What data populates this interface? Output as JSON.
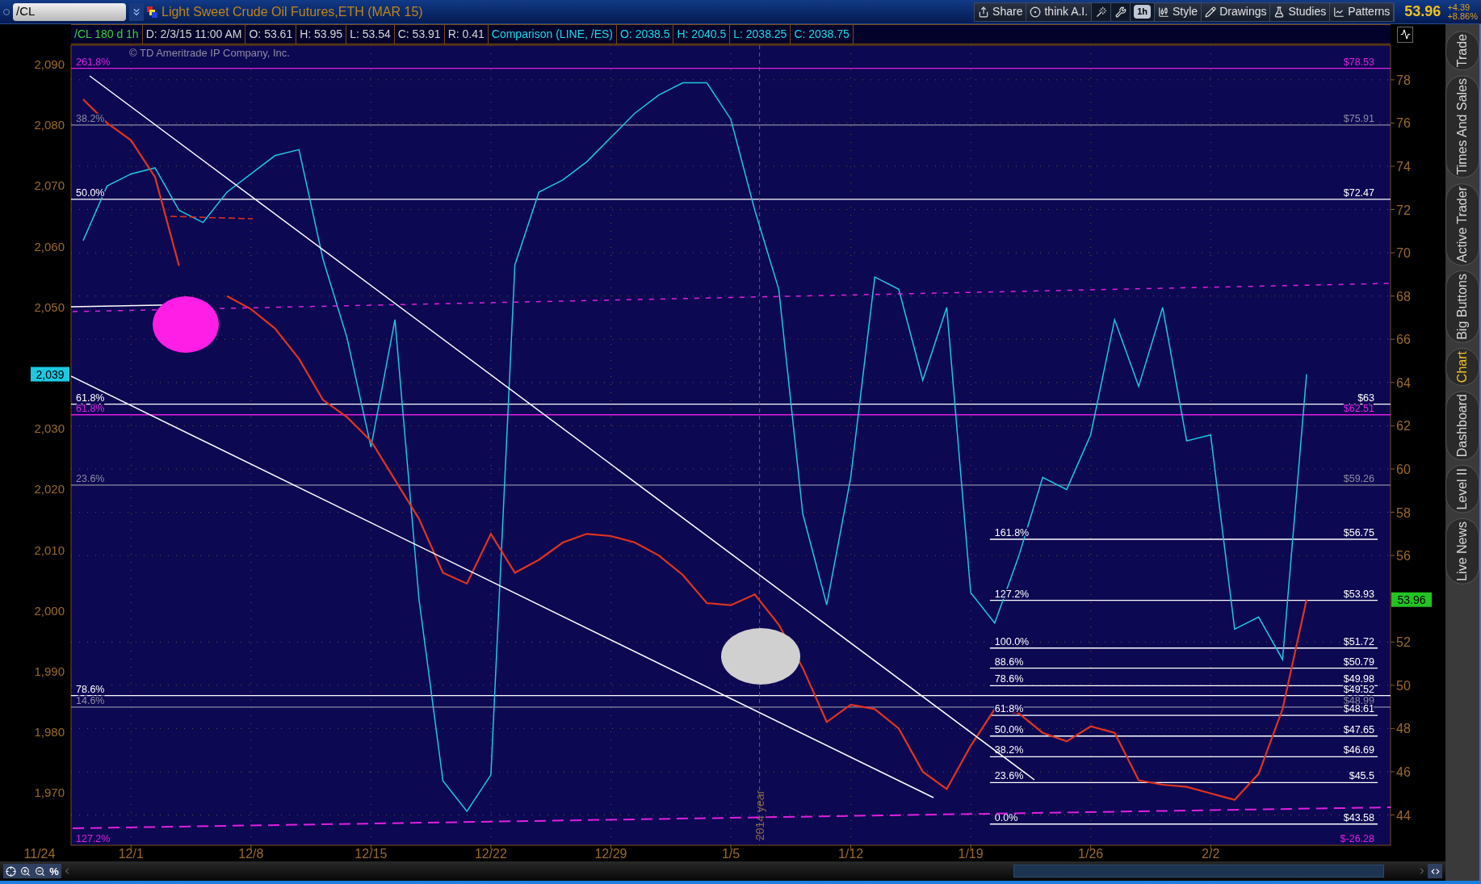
{
  "header": {
    "symbol": "/CL",
    "title": "Light Sweet Crude Oil Futures,ETH (MAR 15)",
    "toolbar": [
      {
        "kind": "button",
        "label": "Share"
      },
      {
        "kind": "button",
        "label": "think A.I."
      },
      {
        "kind": "icon"
      },
      {
        "kind": "icon"
      },
      {
        "kind": "chip",
        "label": "1h"
      },
      {
        "kind": "button",
        "label": "Style"
      },
      {
        "kind": "button",
        "label": "Drawings"
      },
      {
        "kind": "button",
        "label": "Studies"
      },
      {
        "kind": "button",
        "label": "Patterns"
      }
    ],
    "last_price": "53.96",
    "change": "+4.39",
    "change_percent": "+8.86%"
  },
  "info_bar": [
    {
      "kind": "study",
      "text": "/CL 180 d 1h"
    },
    {
      "kind": "quote",
      "text": "D: 2/3/15 11:00 AM"
    },
    {
      "kind": "quote",
      "text": "O: 53.61"
    },
    {
      "kind": "quote",
      "text": "H: 53.95"
    },
    {
      "kind": "quote",
      "text": "L: 53.54"
    },
    {
      "kind": "quote",
      "text": "C: 53.91"
    },
    {
      "kind": "quote",
      "text": "R: 0.41"
    },
    {
      "kind": "comparison",
      "text": "Comparison (LINE, /ES)"
    },
    {
      "kind": "comparison",
      "text": "O: 2038.5"
    },
    {
      "kind": "comparison",
      "text": "H: 2040.5"
    },
    {
      "kind": "comparison",
      "text": "L: 2038.25"
    },
    {
      "kind": "comparison",
      "text": "C: 2038.75"
    }
  ],
  "chart": {
    "copyright": "© TD Ameritrade IP Company, Inc.",
    "first_date_label": "11/24",
    "separator_label": "2014 year",
    "badges": [
      {
        "text": "2,039",
        "color": "#1ec8e0"
      },
      {
        "text": "53.96",
        "color": "#22c322"
      }
    ],
    "fib_levels": [
      {
        "percent": "261.8%",
        "kind": "full"
      },
      {
        "percent": "38.2%",
        "kind": "full"
      },
      {
        "percent": "50.0%",
        "kind": "full"
      },
      {
        "percent": "61.8%",
        "kind": "full"
      },
      {
        "percent": "61.8%",
        "kind": "full"
      },
      {
        "percent": "23.6%",
        "kind": "full"
      },
      {
        "percent": "78.6%",
        "kind": "full"
      },
      {
        "percent": "14.6%",
        "kind": "full"
      },
      {
        "percent": "161.8%",
        "kind": "partial"
      },
      {
        "percent": "127.2%",
        "kind": "partial"
      },
      {
        "percent": "100.0%",
        "kind": "partial"
      },
      {
        "percent": "88.6%",
        "kind": "partial"
      },
      {
        "percent": "78.6%",
        "kind": "partial"
      },
      {
        "percent": "61.8%",
        "kind": "partial"
      },
      {
        "percent": "50.0%",
        "kind": "partial"
      },
      {
        "percent": "38.2%",
        "kind": "partial"
      },
      {
        "percent": "23.6%",
        "kind": "partial"
      },
      {
        "percent": "0.0%",
        "kind": "partial"
      }
    ],
    "offscale_level": {
      "percent": "127.2%",
      "price": "$-26.28"
    },
    "chart_data": {
      "type": "line",
      "grid": true,
      "ylim": [
        1961.4,
        2093.2
      ],
      "y2lim": [
        42.6,
        79.6
      ],
      "categories": [
        null,
        null,
        "12/1",
        null,
        null,
        null,
        null,
        "12/8",
        null,
        null,
        null,
        null,
        "12/15",
        null,
        null,
        null,
        null,
        "12/22",
        null,
        null,
        null,
        null,
        "12/29",
        null,
        null,
        null,
        null,
        "1/5",
        null,
        null,
        null,
        null,
        "1/12",
        null,
        null,
        null,
        null,
        "1/19",
        null,
        null,
        null,
        null,
        "1/26",
        null,
        null,
        null,
        null,
        "2/2",
        null,
        null,
        null,
        null,
        null,
        null,
        null
      ],
      "yticks": [
        {
          "value": 2090,
          "label": "2,090"
        },
        {
          "value": 2080,
          "label": "2,080"
        },
        {
          "value": 2070,
          "label": "2,070"
        },
        {
          "value": 2060,
          "label": "2,060"
        },
        {
          "value": 2050,
          "label": "2,050"
        },
        {
          "value": 2030,
          "label": "2,030"
        },
        {
          "value": 2020,
          "label": "2,020"
        },
        {
          "value": 2010,
          "label": "2,010"
        },
        {
          "value": 2000,
          "label": "2,000"
        },
        {
          "value": 1990,
          "label": "1,990"
        },
        {
          "value": 1980,
          "label": "1,980"
        },
        {
          "value": 1970,
          "label": "1,970"
        }
      ],
      "y2ticks": [
        78,
        76,
        74,
        72,
        70,
        68,
        66,
        64,
        62,
        60,
        58,
        56,
        52,
        50,
        48,
        46,
        44
      ],
      "series": [
        {
          "color": "#1ec8e0",
          "values": [
            2061,
            2070,
            2072,
            2073,
            2066,
            2064,
            2069,
            2072,
            2075,
            2076,
            2058,
            2045,
            2027,
            2048,
            2002,
            1972,
            1967,
            1973,
            2057,
            2069,
            2071,
            2074,
            2078,
            2082,
            2085,
            2087,
            2087,
            2081,
            2066,
            2053,
            2016,
            2001,
            2022,
            2055,
            2053,
            2038,
            2050,
            2003,
            1998,
            2009,
            2022,
            2020,
            2029,
            2048,
            2037,
            2050,
            2028,
            2029,
            1997,
            1999,
            1992,
            2039,
            null,
            null,
            null
          ]
        },
        {
          "color": "#e0341e",
          "axis": "y2",
          "values": [
            77.1,
            76.0,
            75.2,
            73.5,
            69.4,
            null,
            68.0,
            67.4,
            66.5,
            65.1,
            63.2,
            62.4,
            61.3,
            59.5,
            57.7,
            55.2,
            54.7,
            57.0,
            55.2,
            55.8,
            56.6,
            57.0,
            56.9,
            56.6,
            56.0,
            55.1,
            53.8,
            53.7,
            54.2,
            52.8,
            50.8,
            48.3,
            49.1,
            48.9,
            48.0,
            46.0,
            45.2,
            47.2,
            48.9,
            48.7,
            47.8,
            47.4,
            48.1,
            47.8,
            45.6,
            45.4,
            45.3,
            45.0,
            44.7,
            45.9,
            48.9,
            53.96,
            null,
            null,
            null
          ]
        }
      ],
      "ref_lines": [
        {
          "axis": "y2",
          "value": 78.53,
          "color": "#e020e0",
          "label": "$78.53"
        },
        {
          "axis": "y2",
          "value": 75.91,
          "color": "#8c8ca0",
          "label": "$75.91"
        },
        {
          "axis": "y2",
          "value": 72.47,
          "color": "#ffffff",
          "label": "$72.47"
        },
        {
          "axis": "y2",
          "value": 63,
          "color": "#ffffff",
          "label": "$63"
        },
        {
          "axis": "y2",
          "value": 62.51,
          "color": "#e020e0",
          "label": "$62.51"
        },
        {
          "axis": "y2",
          "value": 59.26,
          "color": "#8c8ca0",
          "label": "$59.26"
        },
        {
          "axis": "y2",
          "value": 49.52,
          "color": "#ffffff",
          "label": "$49.52"
        },
        {
          "axis": "y2",
          "value": 48.99,
          "color": "#8c8ca0",
          "label": "$48.99"
        },
        {
          "axis": "y2",
          "value": 56.75,
          "color": "#ffffff",
          "label": "$56.75"
        },
        {
          "axis": "y2",
          "value": 53.93,
          "color": "#ffffff",
          "label": "$53.93"
        },
        {
          "axis": "y2",
          "value": 51.72,
          "color": "#ffffff",
          "label": "$51.72"
        },
        {
          "axis": "y2",
          "value": 50.79,
          "color": "#ffffff",
          "label": "$50.79"
        },
        {
          "axis": "y2",
          "value": 49.98,
          "color": "#ffffff",
          "label": "$49.98"
        },
        {
          "axis": "y2",
          "value": 48.61,
          "color": "#ffffff",
          "label": "$48.61"
        },
        {
          "axis": "y2",
          "value": 47.65,
          "color": "#ffffff",
          "label": "$47.65"
        },
        {
          "axis": "y2",
          "value": 46.69,
          "color": "#ffffff",
          "label": "$46.69"
        },
        {
          "axis": "y2",
          "value": 45.5,
          "color": "#ffffff",
          "label": "$45.5"
        },
        {
          "axis": "y2",
          "value": 43.58,
          "color": "#ffffff",
          "label": "$43.58"
        }
      ]
    }
  },
  "side_tabs": [
    {
      "label": "Trade",
      "selected": false
    },
    {
      "label": "Times And Sales",
      "selected": false
    },
    {
      "label": "Active Trader",
      "selected": false
    },
    {
      "label": "Big Buttons",
      "selected": false
    },
    {
      "label": "Chart",
      "selected": true
    },
    {
      "label": "Dashboard",
      "selected": false
    },
    {
      "label": "Level II",
      "selected": false
    },
    {
      "label": "Live News",
      "selected": false
    }
  ],
  "bottom_toolbar": {
    "percent_label": "%"
  }
}
